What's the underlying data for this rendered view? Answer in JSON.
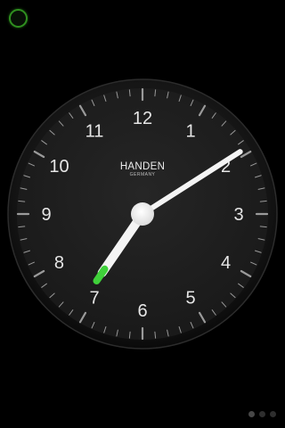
{
  "clock": {
    "brand": "HANDEN",
    "subtitle": "GERMANY",
    "numerals": [
      "12",
      "1",
      "2",
      "3",
      "4",
      "5",
      "6",
      "7",
      "8",
      "9",
      "10",
      "11"
    ],
    "time": {
      "hour": 7,
      "minute": 9,
      "second": 35
    },
    "colors": {
      "face": "#1f1f1f",
      "bezel": "#101010",
      "hands": "#f4f4f4",
      "seconds_hand": "#3fd13a",
      "ticks": "#9a9a9a"
    }
  },
  "alarm_button": {
    "icon": "alarm-ring-icon",
    "color": "#2f8f1f"
  },
  "pager": {
    "pages": 3,
    "active_index": 0
  }
}
